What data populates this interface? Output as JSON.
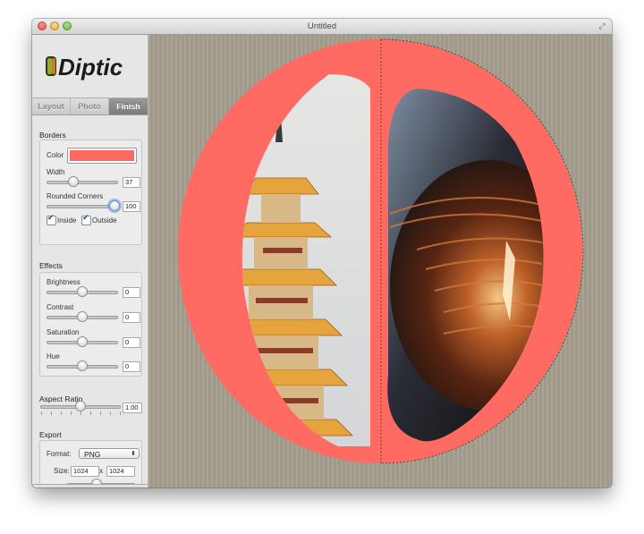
{
  "window": {
    "title": "Untitled"
  },
  "app": {
    "logo_text": "Diptic"
  },
  "tabs": [
    {
      "label": "Layout",
      "selected": false
    },
    {
      "label": "Photo",
      "selected": false
    },
    {
      "label": "Finish",
      "selected": true
    }
  ],
  "borders": {
    "heading": "Borders",
    "color_label": "Color",
    "color_value": "#ff6b62",
    "width_label": "Width",
    "width_value": "37",
    "width_level": 0.37,
    "corners_label": "Rounded Corners",
    "corners_value": "100",
    "corners_level": 1.0,
    "inside_label": "Inside",
    "inside_checked": true,
    "outside_label": "Outside",
    "outside_checked": true
  },
  "effects": {
    "heading": "Effects",
    "brightness_label": "Brightness",
    "brightness_value": "0",
    "contrast_label": "Contrast",
    "contrast_value": "0",
    "saturation_label": "Saturation",
    "saturation_value": "0",
    "hue_label": "Hue",
    "hue_value": "0"
  },
  "aspect": {
    "heading": "Aspect Ratio",
    "value": "1.00"
  },
  "export": {
    "heading": "Export",
    "format_label": "Format:",
    "format_value": "PNG",
    "size_label": "Size:",
    "width": "1024",
    "times": "x",
    "height": "1024"
  },
  "colors": {
    "border": "#ff6b62",
    "canvas": "#a59d8c",
    "sidebar": "#e6e6e6"
  }
}
